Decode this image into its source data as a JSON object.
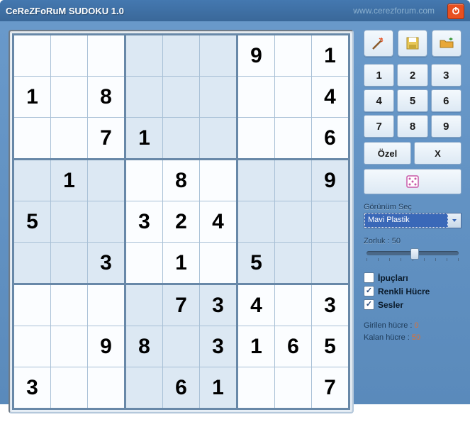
{
  "title": "CeReZFoRuM SUDOKU 1.0",
  "url": "www.cerezforum.com",
  "board": [
    [
      "",
      "",
      "",
      "",
      "",
      "",
      "9",
      "",
      "1"
    ],
    [
      "1",
      "",
      "8",
      "",
      "",
      "",
      "",
      "",
      "4"
    ],
    [
      "",
      "",
      "7",
      "1",
      "",
      "",
      "",
      "",
      "6"
    ],
    [
      "",
      "1",
      "",
      "",
      "8",
      "",
      "",
      "",
      "9"
    ],
    [
      "5",
      "",
      "",
      "3",
      "2",
      "4",
      "",
      "",
      ""
    ],
    [
      "",
      "",
      "3",
      "",
      "1",
      "",
      "5",
      "",
      ""
    ],
    [
      "",
      "",
      "",
      "",
      "7",
      "3",
      "4",
      "",
      "3"
    ],
    [
      "",
      "",
      "9",
      "8",
      "",
      "3",
      "1",
      "6",
      "5"
    ],
    [
      "3",
      "",
      "",
      "",
      "6",
      "1",
      "",
      "",
      "7"
    ]
  ],
  "numpad": [
    "1",
    "2",
    "3",
    "4",
    "5",
    "6",
    "7",
    "8",
    "9"
  ],
  "special": {
    "ozel": "Özel",
    "x": "X"
  },
  "view": {
    "label": "Görünüm Seç",
    "value": "Mavi Plastik"
  },
  "difficulty": {
    "label": "Zorluk : 50",
    "value": 50
  },
  "checks": {
    "hints": {
      "label": "İpuçları",
      "checked": false
    },
    "colored": {
      "label": "Renkli Hücre",
      "checked": true
    },
    "sounds": {
      "label": "Sesler",
      "checked": true
    }
  },
  "stats": {
    "entered_label": "Girilen hücre  :  ",
    "entered": "0",
    "remain_label": "Kalan hücre  :  ",
    "remain": "50"
  }
}
